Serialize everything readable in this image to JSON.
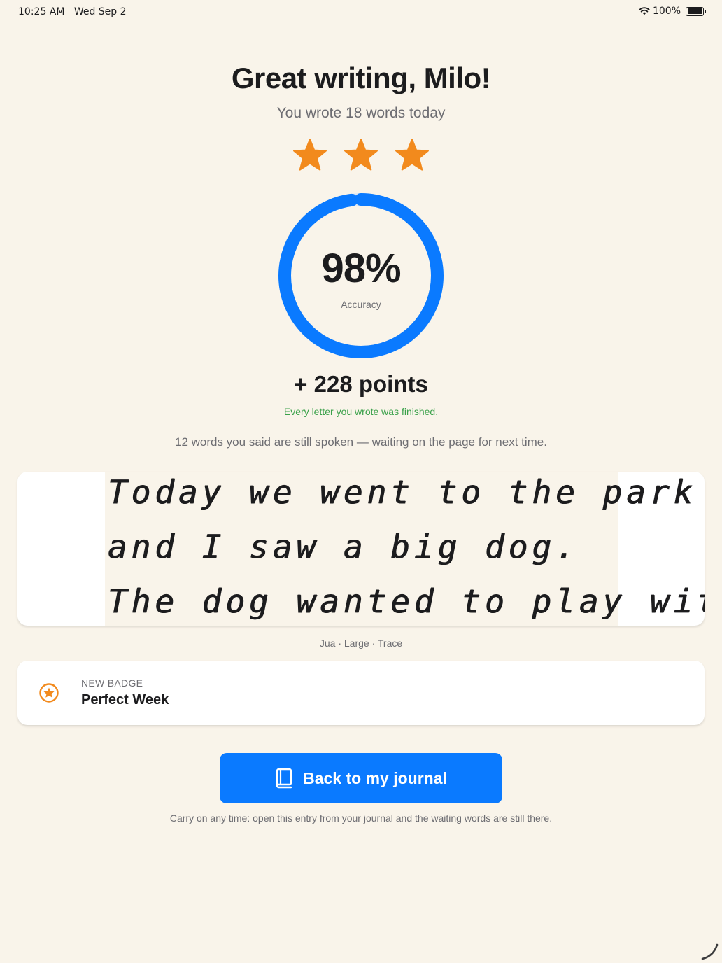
{
  "status_bar": {
    "time": "10:25 AM",
    "date": "Wed Sep 2",
    "battery": "100%"
  },
  "header": {
    "title": "Great writing, Milo!",
    "subtitle": "You wrote 18 words today"
  },
  "stars": {
    "earned": 3,
    "total": 3,
    "color": "#f28a1d"
  },
  "accuracy": {
    "value": "98%",
    "fraction": 0.98,
    "label": "Accuracy",
    "color": "#0a7aff"
  },
  "points": {
    "text": "+ 228 points"
  },
  "notes": {
    "finished": "Every letter you wrote was finished.",
    "waiting": "12 words you said are still spoken — waiting on the page for next time."
  },
  "writing": {
    "lines": [
      "Today we went to the park",
      "and I saw a big dog.",
      "The dog wanted to play with"
    ],
    "caption": "Jua · Large · Trace"
  },
  "badge": {
    "kicker": "NEW BADGE",
    "name": "Perfect Week",
    "icon": "star-badge-icon",
    "color": "#f28a1d"
  },
  "actions": {
    "back_label": "Back to my journal",
    "back_icon": "book-icon",
    "footer": "Carry on any time: open this entry from your journal and the waiting words are still there."
  }
}
